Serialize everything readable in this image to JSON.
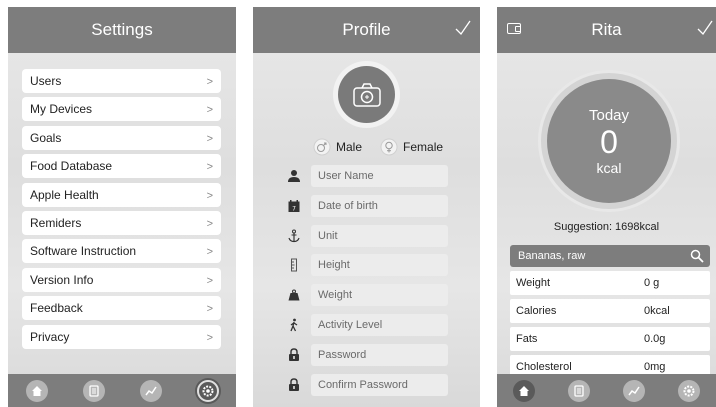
{
  "settings": {
    "title": "Settings",
    "items": [
      {
        "label": "Users"
      },
      {
        "label": "My Devices"
      },
      {
        "label": "Goals"
      },
      {
        "label": "Food Database"
      },
      {
        "label": "Apple Health"
      },
      {
        "label": "Remiders"
      },
      {
        "label": "Software Instruction"
      },
      {
        "label": "Version Info"
      },
      {
        "label": "Feedback"
      },
      {
        "label": "Privacy"
      }
    ],
    "chevron": ">"
  },
  "profile": {
    "title": "Profile",
    "gender": {
      "male": "Male",
      "female": "Female"
    },
    "fields": [
      {
        "placeholder": "User Name",
        "icon": "person-icon"
      },
      {
        "placeholder": "Date of birth",
        "icon": "calendar-icon"
      },
      {
        "placeholder": "Unit",
        "icon": "anchor-icon"
      },
      {
        "placeholder": "Height",
        "icon": "ruler-icon"
      },
      {
        "placeholder": "Weight",
        "icon": "weight-icon"
      },
      {
        "placeholder": "Activity Level",
        "icon": "walking-icon"
      },
      {
        "placeholder": "Password",
        "icon": "lock-icon"
      },
      {
        "placeholder": "Confirm Password",
        "icon": "lock-icon"
      }
    ]
  },
  "rita": {
    "title": "Rita",
    "today": "Today",
    "kcal_value": "0",
    "kcal_unit": "kcal",
    "suggestion": "Suggestion: 1698kcal",
    "food": "Bananas, raw",
    "nutrients": [
      {
        "name": "Weight",
        "value": "0 g"
      },
      {
        "name": "Calories",
        "value": "0kcal"
      },
      {
        "name": "Fats",
        "value": "0.0g"
      },
      {
        "name": "Cholesterol",
        "value": "0mg"
      }
    ]
  },
  "tabbar": {
    "tabs": [
      "home-icon",
      "list-icon",
      "chart-icon",
      "settings-icon"
    ]
  },
  "colors": {
    "bar": "#7d7d7d",
    "field": "#ececec",
    "accent": "#8a8a8a"
  }
}
